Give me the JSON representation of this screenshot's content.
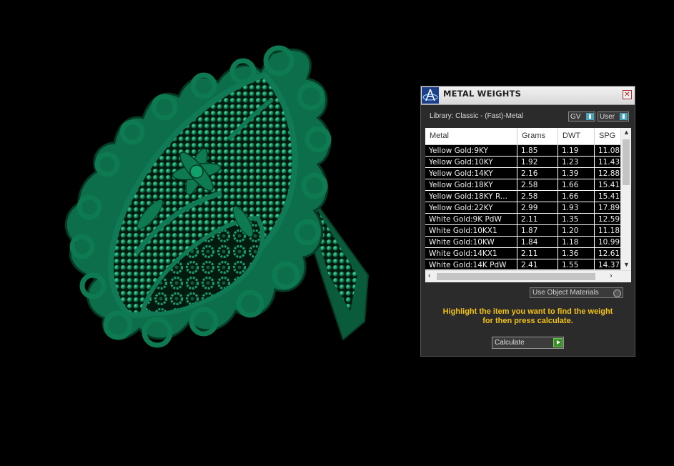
{
  "window": {
    "title": "METAL WEIGHTS",
    "close_icon": "close-icon",
    "logo_icon": "app-logo-icon"
  },
  "library": {
    "label": "Library: Classic - (Fast)-Metal"
  },
  "toggles": {
    "gv_label": "GV",
    "user_label": "User"
  },
  "table": {
    "columns": [
      "Metal",
      "Grams",
      "DWT",
      "SPG"
    ],
    "rows": [
      {
        "metal": "Yellow Gold:9KY",
        "grams": "1.85",
        "dwt": "1.19",
        "spg": "11.08"
      },
      {
        "metal": "Yellow Gold:10KY",
        "grams": "1.92",
        "dwt": "1.23",
        "spg": "11.43"
      },
      {
        "metal": "Yellow Gold:14KY",
        "grams": "2.16",
        "dwt": "1.39",
        "spg": "12.88"
      },
      {
        "metal": "Yellow Gold:18KY",
        "grams": "2.58",
        "dwt": "1.66",
        "spg": "15.41"
      },
      {
        "metal": "Yellow Gold:18KY R...",
        "grams": "2.58",
        "dwt": "1.66",
        "spg": "15.41"
      },
      {
        "metal": "Yellow Gold:22KY",
        "grams": "2.99",
        "dwt": "1.93",
        "spg": "17.89"
      },
      {
        "metal": "White Gold:9K PdW",
        "grams": "2.11",
        "dwt": "1.35",
        "spg": "12.59"
      },
      {
        "metal": "White Gold:10KX1",
        "grams": "1.87",
        "dwt": "1.20",
        "spg": "11.18"
      },
      {
        "metal": "White Gold:10KW",
        "grams": "1.84",
        "dwt": "1.18",
        "spg": "10.99"
      },
      {
        "metal": "White Gold:14KX1",
        "grams": "2.11",
        "dwt": "1.36",
        "spg": "12.61"
      },
      {
        "metal": "White Gold:14K PdW",
        "grams": "2.41",
        "dwt": "1.55",
        "spg": "14.37"
      }
    ]
  },
  "options": {
    "use_object_materials": "Use Object Materials"
  },
  "instruction": {
    "line1": "Highlight the item you want to find the weight",
    "line2": "for then press calculate."
  },
  "actions": {
    "calculate_label": "Calculate"
  },
  "colors": {
    "ring": "#0f7a55",
    "instruction_text": "#f2c21a",
    "accent": "#4aa3b8"
  }
}
